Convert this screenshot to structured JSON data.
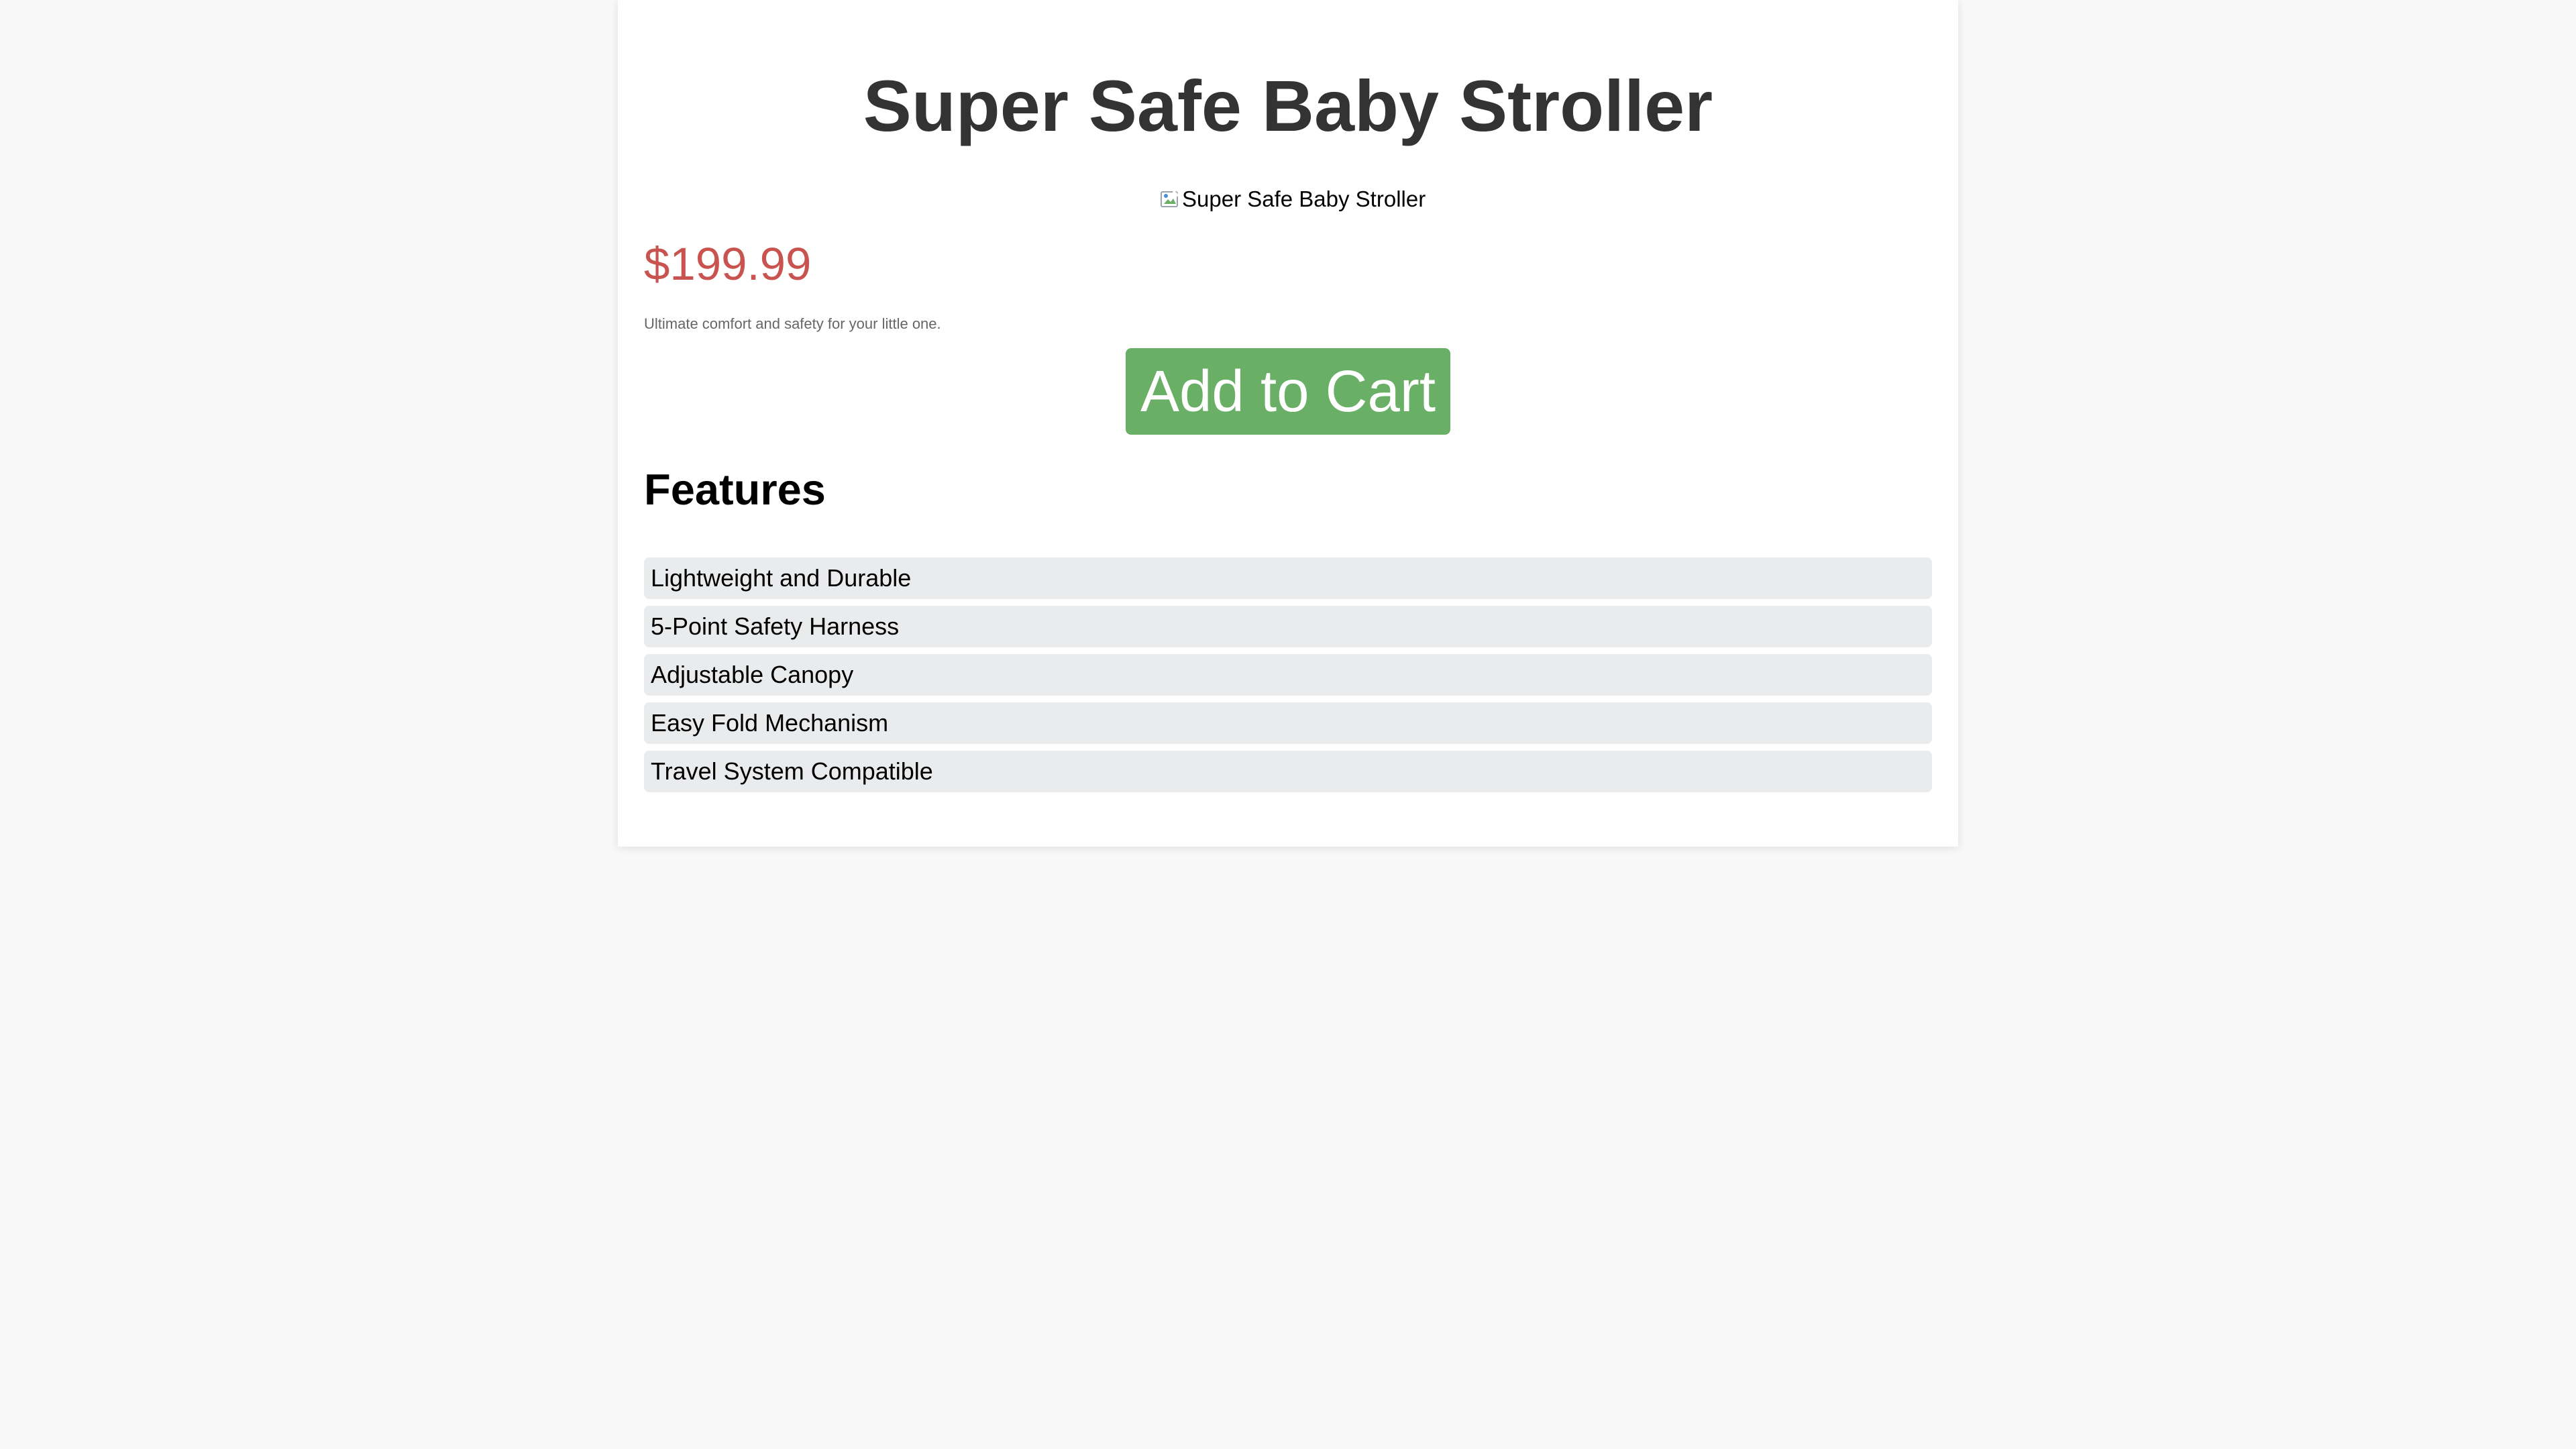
{
  "product": {
    "title": "Super Safe Baby Stroller",
    "image_alt": "Super Safe Baby Stroller",
    "price": "$199.99",
    "description": "Ultimate comfort and safety for your little one.",
    "add_to_cart_label": "Add to Cart"
  },
  "features": {
    "heading": "Features",
    "items": [
      {
        "label": "Lightweight and Durable"
      },
      {
        "label": "5-Point Safety Harness"
      },
      {
        "label": "Adjustable Canopy"
      },
      {
        "label": "Easy Fold Mechanism"
      },
      {
        "label": "Travel System Compatible"
      }
    ]
  },
  "colors": {
    "page_background": "#f8f8f8",
    "card_background": "#ffffff",
    "title_text": "#333333",
    "price_text": "#c9534f",
    "description_text": "#666666",
    "button_background": "#6aaf66",
    "button_text": "#ffffff",
    "feature_background": "#eaebed"
  },
  "icons": {
    "product_image": "broken-image-icon"
  }
}
